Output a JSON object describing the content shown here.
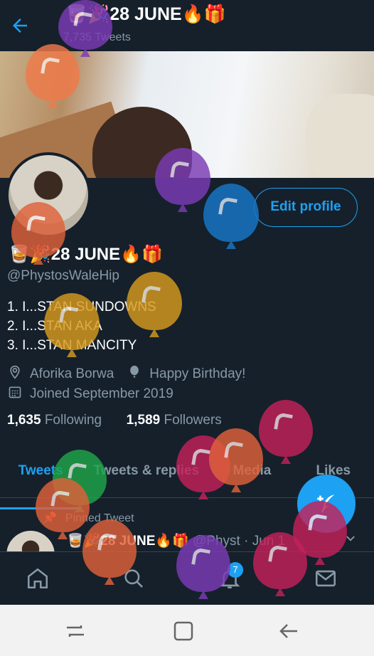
{
  "header": {
    "back_icon": "arrow-left-icon",
    "title": "🥃🎉28 JUNE🔥🎁",
    "tweet_count": "7,735 Tweets"
  },
  "profile": {
    "edit_label": "Edit profile",
    "display_name": "🥃🎉28 JUNE🔥🎁",
    "handle": "@PhystosWaleHip",
    "bio": [
      "1. I...STAN SUNDOWNS",
      "2. I...STAN AKA",
      "3. I...STAN MANCITY"
    ],
    "location": "Aforika Borwa",
    "birthday": "Happy Birthday!",
    "joined": "Joined September 2019",
    "following_count": "1,635",
    "following_label": "Following",
    "followers_count": "1,589",
    "followers_label": "Followers"
  },
  "tabs": [
    {
      "label": "Tweets",
      "active": true
    },
    {
      "label": "Tweets & replies",
      "active": false
    },
    {
      "label": "Media",
      "active": false
    },
    {
      "label": "Likes",
      "active": false
    }
  ],
  "pinned_tweet": {
    "pinned_label": "Pinned Tweet",
    "author": "🥃🎉28 JUNE🔥🎁",
    "handle": "@Physt",
    "separator": "·",
    "date": "Jun 1"
  },
  "bottom_nav": {
    "items": [
      "home-icon",
      "search-icon",
      "bell-icon",
      "mail-icon"
    ],
    "notification_badge": "7"
  },
  "colors": {
    "background": "#15202b",
    "accent": "#1da1f2",
    "muted": "#8899a6",
    "divider": "#38444d"
  }
}
